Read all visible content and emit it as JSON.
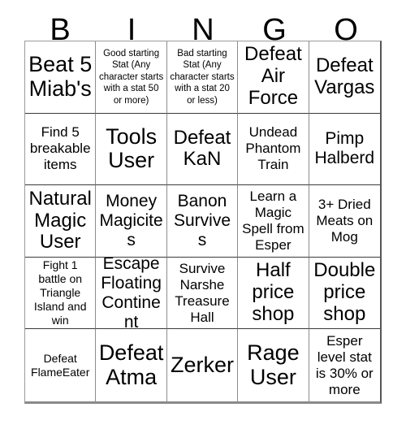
{
  "card": {
    "title_letters": [
      "B",
      "I",
      "N",
      "G",
      "O"
    ],
    "columns": 5,
    "rows": 5,
    "colors": {
      "background": "#ffffff",
      "text": "#000000",
      "grid_line": "#3a3a3a",
      "outer_border": "#8a8a8a"
    },
    "squares": [
      {
        "row": 1,
        "col": "B",
        "text": "Beat 5 Miab's",
        "size": "xxl"
      },
      {
        "row": 1,
        "col": "I",
        "text": "Good starting Stat (Any character starts with a stat 50 or more)",
        "size": "xs"
      },
      {
        "row": 1,
        "col": "N",
        "text": "Bad starting Stat (Any character starts with a stat 20 or less)",
        "size": "xs"
      },
      {
        "row": 1,
        "col": "G",
        "text": "Defeat Air Force",
        "size": "xl"
      },
      {
        "row": 1,
        "col": "O",
        "text": "Defeat Vargas",
        "size": "xl"
      },
      {
        "row": 2,
        "col": "B",
        "text": "Find 5 breakable items",
        "size": "md"
      },
      {
        "row": 2,
        "col": "I",
        "text": "Tools User",
        "size": "xxl"
      },
      {
        "row": 2,
        "col": "N",
        "text": "Defeat KaN",
        "size": "xl"
      },
      {
        "row": 2,
        "col": "G",
        "text": "Undead Phantom Train",
        "size": "md"
      },
      {
        "row": 2,
        "col": "O",
        "text": "Pimp Halberd",
        "size": "lg"
      },
      {
        "row": 3,
        "col": "B",
        "text": "Natural Magic User",
        "size": "xl"
      },
      {
        "row": 3,
        "col": "I",
        "text": "Money Magicites",
        "size": "lg"
      },
      {
        "row": 3,
        "col": "N",
        "text": "Banon Survives",
        "size": "lg"
      },
      {
        "row": 3,
        "col": "G",
        "text": "Learn a Magic Spell from Esper",
        "size": "md"
      },
      {
        "row": 3,
        "col": "O",
        "text": "3+ Dried Meats on Mog",
        "size": "md"
      },
      {
        "row": 4,
        "col": "B",
        "text": "Fight 1 battle on Triangle Island and win",
        "size": "sm"
      },
      {
        "row": 4,
        "col": "I",
        "text": "Escape Floating Continent",
        "size": "lg"
      },
      {
        "row": 4,
        "col": "N",
        "text": "Survive Narshe Treasure Hall",
        "size": "md"
      },
      {
        "row": 4,
        "col": "G",
        "text": "Half price shop",
        "size": "xl"
      },
      {
        "row": 4,
        "col": "O",
        "text": "Double price shop",
        "size": "xl"
      },
      {
        "row": 5,
        "col": "B",
        "text": "Defeat FlameEater",
        "size": "sm"
      },
      {
        "row": 5,
        "col": "I",
        "text": "Defeat Atma",
        "size": "xxl"
      },
      {
        "row": 5,
        "col": "N",
        "text": "Zerker",
        "size": "xxl"
      },
      {
        "row": 5,
        "col": "G",
        "text": "Rage User",
        "size": "xxl"
      },
      {
        "row": 5,
        "col": "O",
        "text": "Esper level stat is 30% or more",
        "size": "md"
      }
    ]
  }
}
